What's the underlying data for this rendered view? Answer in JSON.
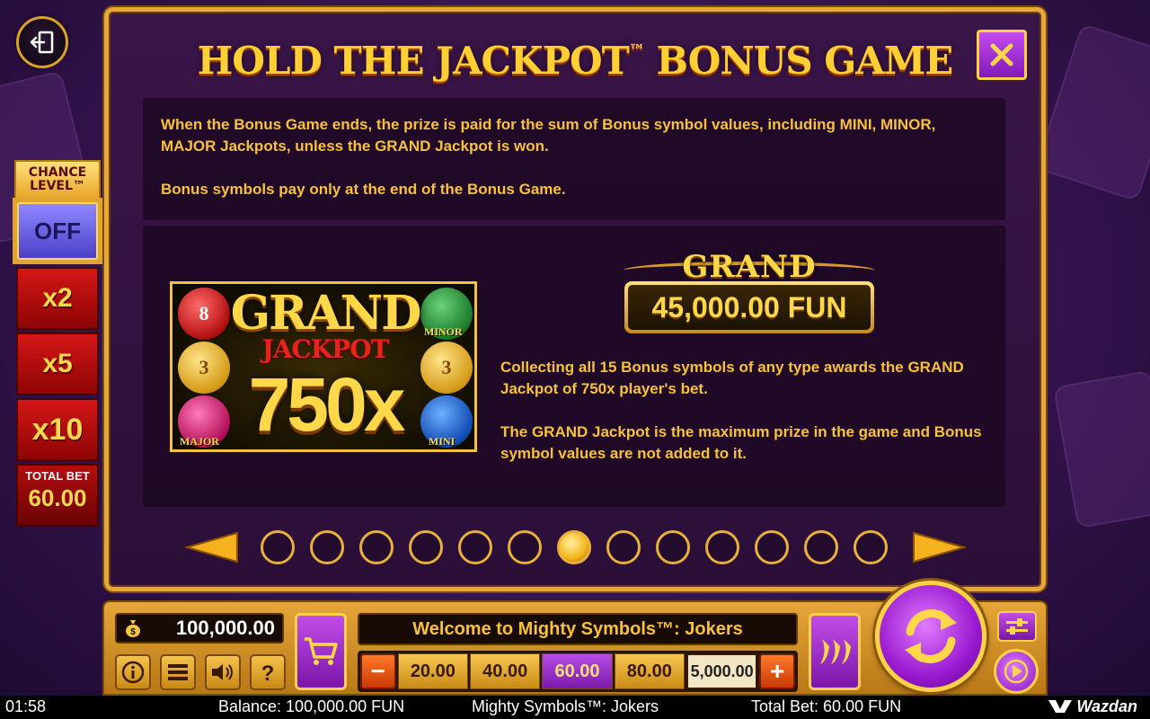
{
  "modal": {
    "title": "HOLD THE JACKPOT",
    "title_tm": "™",
    "title_suffix": " BONUS GAME",
    "rules_top": [
      "When the Bonus Game ends, the prize is paid for the sum of Bonus symbol values, including MINI, MINOR, MAJOR Jackpots, unless the GRAND Jackpot is won.",
      "Bonus symbols pay only at the end of the Bonus Game."
    ],
    "art": {
      "headline": "GRAND",
      "subline": "JACKPOT",
      "multiplier": "750x",
      "coin_values": [
        "8",
        "3",
        "3"
      ],
      "labels": [
        "MINOR",
        "MAJOR",
        "MINI"
      ]
    },
    "grand_badge": {
      "label": "GRAND",
      "value": "45,000.00 FUN"
    },
    "rules_grand": [
      "Collecting all 15 Bonus symbols of any type awards the GRAND Jackpot of 750x player's bet.",
      "The GRAND Jackpot is the maximum prize in the game and Bonus symbol values are not added to it."
    ],
    "pager": {
      "total": 13,
      "active_index": 6
    }
  },
  "chance_level": {
    "title_line1": "CHANCE",
    "title_line2": "LEVEL™",
    "state": "OFF",
    "options": [
      "x2",
      "x5",
      "x10"
    ],
    "total_bet_label": "TOTAL BET",
    "total_bet_value": "60.00"
  },
  "controls": {
    "balance": "100,000.00",
    "welcome": "Welcome to Mighty Symbols™: Jokers",
    "bet_options": [
      "20.00",
      "40.00",
      "60.00",
      "80.00",
      "5,000.00"
    ],
    "bet_selected": "60.00",
    "minus": "−",
    "plus": "+"
  },
  "status_bar": {
    "time": "01:58",
    "balance": "Balance: 100,000.00 FUN",
    "game": "Mighty Symbols™: Jokers",
    "total_bet": "Total Bet: 60.00 FUN",
    "brand": "Wazdan"
  },
  "colors": {
    "accent_gold": "#f5c542",
    "modal_border": "#e5a93a",
    "purple": "#9a1ad0"
  }
}
